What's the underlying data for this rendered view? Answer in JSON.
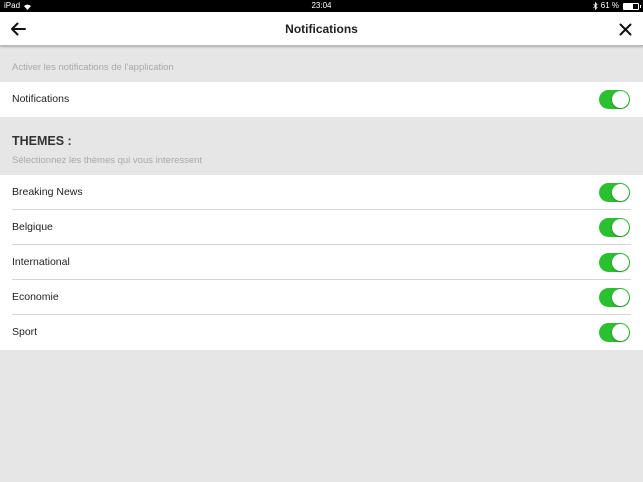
{
  "statusbar": {
    "device": "iPad",
    "time": "23:04",
    "battery": "61 %",
    "battery_level": 0.61
  },
  "navbar": {
    "title": "Notifications",
    "back_icon": "arrow-left-icon",
    "close_icon": "close-icon"
  },
  "general": {
    "caption": "Activer les notifications de l'application",
    "items": [
      {
        "label": "Notifications",
        "enabled": true
      }
    ]
  },
  "themes": {
    "heading": "THEMES :",
    "caption": "Sélectionnez les thèmes qui vous interessent",
    "items": [
      {
        "label": "Breaking News",
        "enabled": true
      },
      {
        "label": "Belgique",
        "enabled": true
      },
      {
        "label": "International",
        "enabled": true
      },
      {
        "label": "Economie",
        "enabled": true
      },
      {
        "label": "Sport",
        "enabled": true
      }
    ]
  },
  "colors": {
    "toggle_on": "#2bc032",
    "background": "#e6e6e6"
  }
}
